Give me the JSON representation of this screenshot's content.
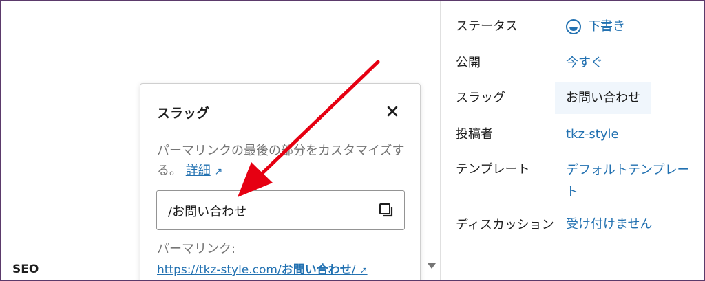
{
  "editor": {
    "seo_label": "SEO"
  },
  "sidebar": {
    "rows": [
      {
        "key": "ステータス",
        "value": "下書き"
      },
      {
        "key": "公開",
        "value": "今すぐ"
      },
      {
        "key": "スラッグ",
        "value": "お問い合わせ"
      },
      {
        "key": "投稿者",
        "value": "tkz-style"
      },
      {
        "key": "テンプレート",
        "value": "デフォルトテンプレート"
      },
      {
        "key": "ディスカッション",
        "value": "受け付けません"
      }
    ]
  },
  "popover": {
    "title": "スラッグ",
    "description": "パーマリンクの最後の部分をカスタマイズする。",
    "learn_more": "詳細",
    "slug_value": "/お問い合わせ",
    "permalink_label": "パーマリンク:",
    "permalink_base": "https://tkz-style.com/",
    "permalink_slug": "お問い合わせ",
    "permalink_trail": "/"
  },
  "colors": {
    "accent": "#2271b1",
    "annotation_arrow": "#e60012",
    "slug_highlight": "#f0f6fc"
  },
  "icons": {
    "status": "draft-half-circle-icon",
    "close": "close-x-icon",
    "copy": "copy-icon",
    "external": "external-link-arrow-icon",
    "collapse": "caret-down-icon"
  }
}
